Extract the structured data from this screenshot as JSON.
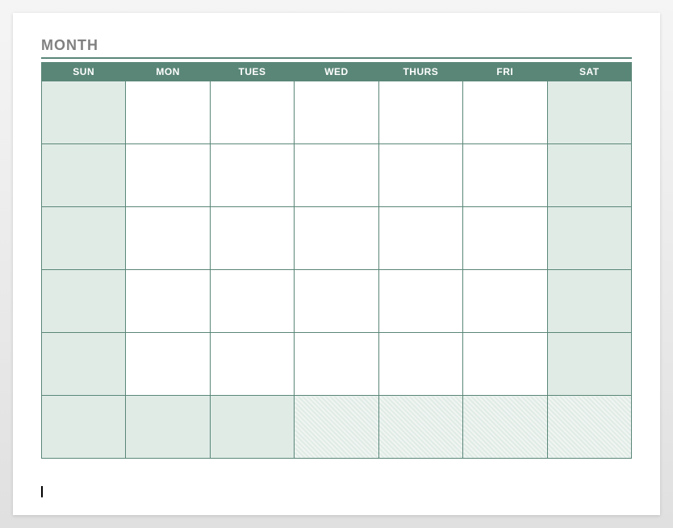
{
  "title": "MONTH",
  "days": [
    "SUN",
    "MON",
    "TUES",
    "WED",
    "THURS",
    "FRI",
    "SAT"
  ],
  "rows": 6,
  "weekendColumns": [
    0,
    6
  ],
  "hatchedCells": [
    {
      "row": 5,
      "col": 3
    },
    {
      "row": 5,
      "col": 4
    },
    {
      "row": 5,
      "col": 5
    },
    {
      "row": 5,
      "col": 6
    }
  ],
  "colors": {
    "accent": "#5a8678",
    "weekendFill": "#e0ebe6",
    "titleGray": "#808080"
  }
}
